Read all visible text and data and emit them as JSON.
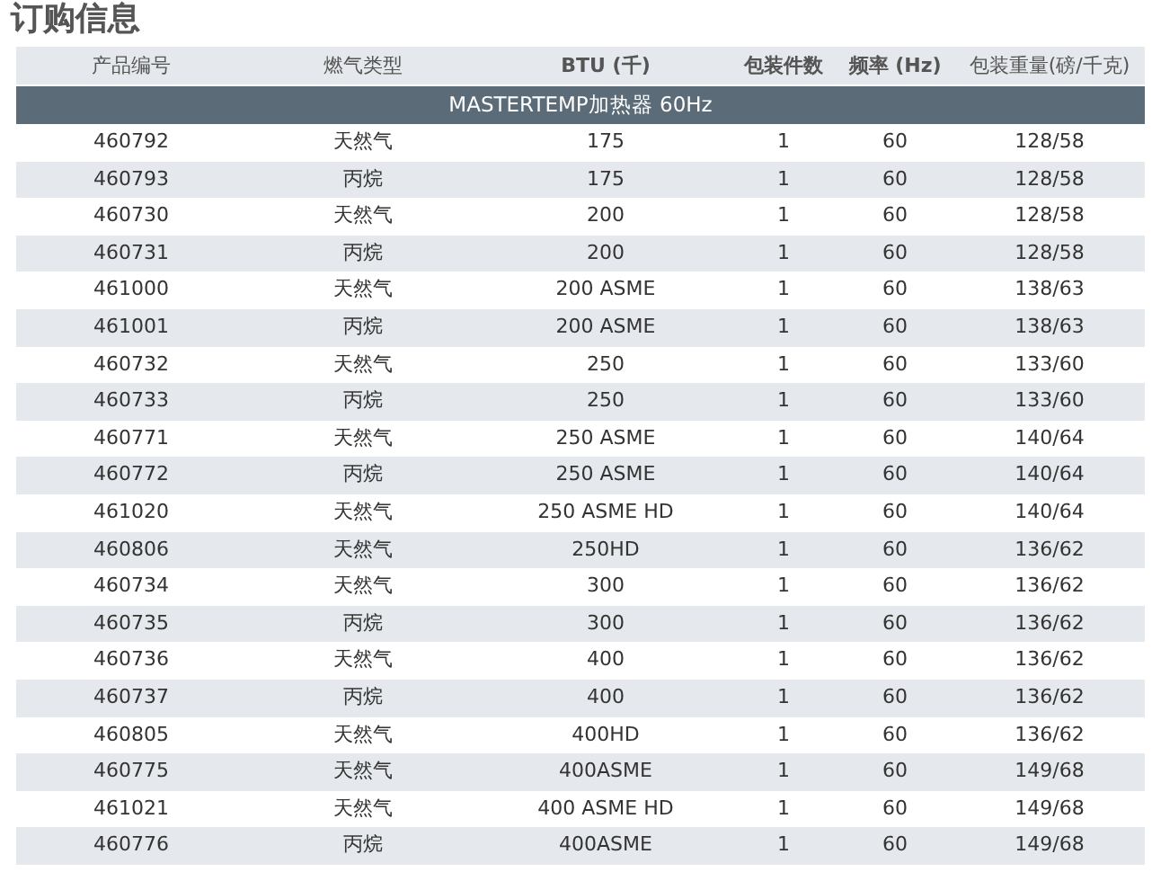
{
  "title": "订购信息",
  "table": {
    "columns": [
      "产品编号",
      "燃气类型",
      "BTU (千)",
      "包装件数",
      "频率 (Hz)",
      "包装重量(磅/千克)"
    ],
    "section": "MASTERTEMP加热器 60Hz",
    "rows": [
      [
        "460792",
        "天然气",
        "175",
        "1",
        "60",
        "128/58"
      ],
      [
        "460793",
        "丙烷",
        "175",
        "1",
        "60",
        "128/58"
      ],
      [
        "460730",
        "天然气",
        "200",
        "1",
        "60",
        "128/58"
      ],
      [
        "460731",
        "丙烷",
        "200",
        "1",
        "60",
        "128/58"
      ],
      [
        "461000",
        "天然气",
        "200 ASME",
        "1",
        "60",
        "138/63"
      ],
      [
        "461001",
        "丙烷",
        "200 ASME",
        "1",
        "60",
        "138/63"
      ],
      [
        "460732",
        "天然气",
        "250",
        "1",
        "60",
        "133/60"
      ],
      [
        "460733",
        "丙烷",
        "250",
        "1",
        "60",
        "133/60"
      ],
      [
        "460771",
        "天然气",
        "250 ASME",
        "1",
        "60",
        "140/64"
      ],
      [
        "460772",
        "丙烷",
        "250 ASME",
        "1",
        "60",
        "140/64"
      ],
      [
        "461020",
        "天然气",
        "250 ASME HD",
        "1",
        "60",
        "140/64"
      ],
      [
        "460806",
        "天然气",
        "250HD",
        "1",
        "60",
        "136/62"
      ],
      [
        "460734",
        "天然气",
        "300",
        "1",
        "60",
        "136/62"
      ],
      [
        "460735",
        "丙烷",
        "300",
        "1",
        "60",
        "136/62"
      ],
      [
        "460736",
        "天然气",
        "400",
        "1",
        "60",
        "136/62"
      ],
      [
        "460737",
        "丙烷",
        "400",
        "1",
        "60",
        "136/62"
      ],
      [
        "460805",
        "天然气",
        "400HD",
        "1",
        "60",
        "136/62"
      ],
      [
        "460775",
        "天然气",
        "400ASME",
        "1",
        "60",
        "149/68"
      ],
      [
        "461021",
        "天然气",
        "400 ASME HD",
        "1",
        "60",
        "149/68"
      ],
      [
        "460776",
        "丙烷",
        "400ASME",
        "1",
        "60",
        "149/68"
      ]
    ]
  }
}
